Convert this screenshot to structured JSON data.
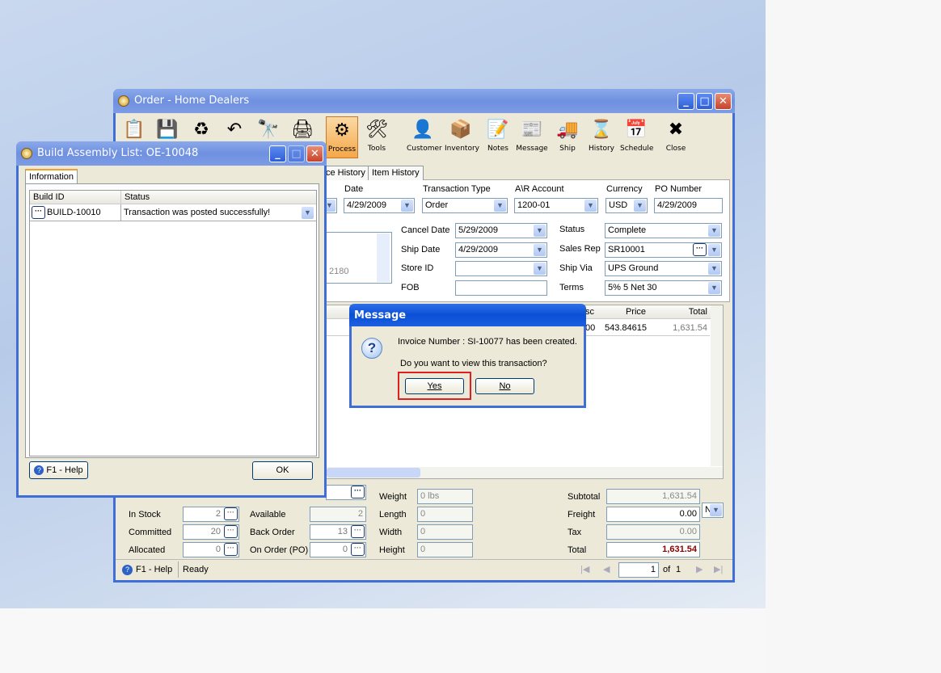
{
  "order_window": {
    "title": "Order - Home Dealers",
    "toolbar": [
      {
        "label": "",
        "icon": "new-icon"
      },
      {
        "label": "",
        "icon": "save-icon"
      },
      {
        "label": "",
        "icon": "delete-icon"
      },
      {
        "label": "",
        "icon": "undo-icon"
      },
      {
        "label": "",
        "icon": "search-icon"
      },
      {
        "label": "",
        "icon": "print-icon"
      },
      {
        "label": "Process",
        "icon": "process-icon"
      },
      {
        "label": "Tools",
        "icon": "tools-icon"
      },
      {
        "label": "Customer",
        "icon": "customer-icon"
      },
      {
        "label": "Inventory",
        "icon": "inventory-icon"
      },
      {
        "label": "Notes",
        "icon": "notes-icon"
      },
      {
        "label": "Message",
        "icon": "message-icon"
      },
      {
        "label": "Ship",
        "icon": "ship-icon"
      },
      {
        "label": "History",
        "icon": "history-icon"
      },
      {
        "label": "Schedule",
        "icon": "schedule-icon"
      },
      {
        "label": "Close",
        "icon": "close-icon"
      }
    ],
    "tabs": [
      "ce History",
      "Item History"
    ],
    "header": {
      "date_label": "Date",
      "date": "4/29/2009",
      "type_label": "Transaction Type",
      "type": "Order",
      "ar_label": "A\\R Account",
      "ar": "1200-01",
      "currency_label": "Currency",
      "currency": "USD",
      "po_label": "PO Number",
      "po": "4/29/2009"
    },
    "address_fragment": "2180",
    "fields": {
      "cancel_date_label": "Cancel  Date",
      "cancel_date": "5/29/2009",
      "ship_date_label": "Ship Date",
      "ship_date": "4/29/2009",
      "store_label": "Store ID",
      "store": "",
      "fob_label": "FOB",
      "fob": "",
      "status_label": "Status",
      "status": "Complete",
      "salesrep_label": "Sales Rep",
      "salesrep": "SR10001",
      "shipvia_label": "Ship Via",
      "shipvia": "UPS Ground",
      "terms_label": "Terms",
      "terms": "5% 5 Net 30"
    },
    "grid": {
      "columns": [
        "sc",
        "Price",
        "Total"
      ],
      "rows": [
        [
          "00",
          "543.84615",
          "1,631.54"
        ]
      ]
    },
    "bottom": {
      "instock_label": "In Stock",
      "instock": "2",
      "committed_label": "Committed",
      "committed": "20",
      "allocated_label": "Allocated",
      "allocated": "0",
      "available_label": "Available",
      "available": "2",
      "backorder_label": "Back Order",
      "backorder": "13",
      "onorder_label": "On Order (PO)",
      "onorder": "0",
      "weight_label": "Weight",
      "weight": "0 lbs",
      "length_label": "Length",
      "length": "0",
      "width_label": "Width",
      "width": "0",
      "height_label": "Height",
      "height": "0",
      "subtotal_label": "Subtotal",
      "subtotal": "1,631.54",
      "freight_label": "Freight",
      "freight": "0.00",
      "freight_code": "N",
      "tax_label": "Tax",
      "tax": "0.00",
      "total_label": "Total",
      "total": "1,631.54",
      "total_color": "#8b0000"
    },
    "status": {
      "help": "F1 - Help",
      "text": "Ready",
      "page": "1",
      "of": "of",
      "pages": "1"
    }
  },
  "build_window": {
    "title": "Build Assembly List: OE-10048",
    "tab": "Information",
    "columns": [
      "Build ID",
      "Status"
    ],
    "rows": [
      {
        "id": "BUILD-10010",
        "status": "Transaction was posted successfully!"
      }
    ],
    "help": "F1 - Help",
    "ok": "OK"
  },
  "message": {
    "title": "Message",
    "line1": "Invoice Number : SI-10077 has been created.",
    "line2": "Do you want to view this transaction?",
    "yes": "Yes",
    "no": "No",
    "highlight_color": "#e02020"
  }
}
